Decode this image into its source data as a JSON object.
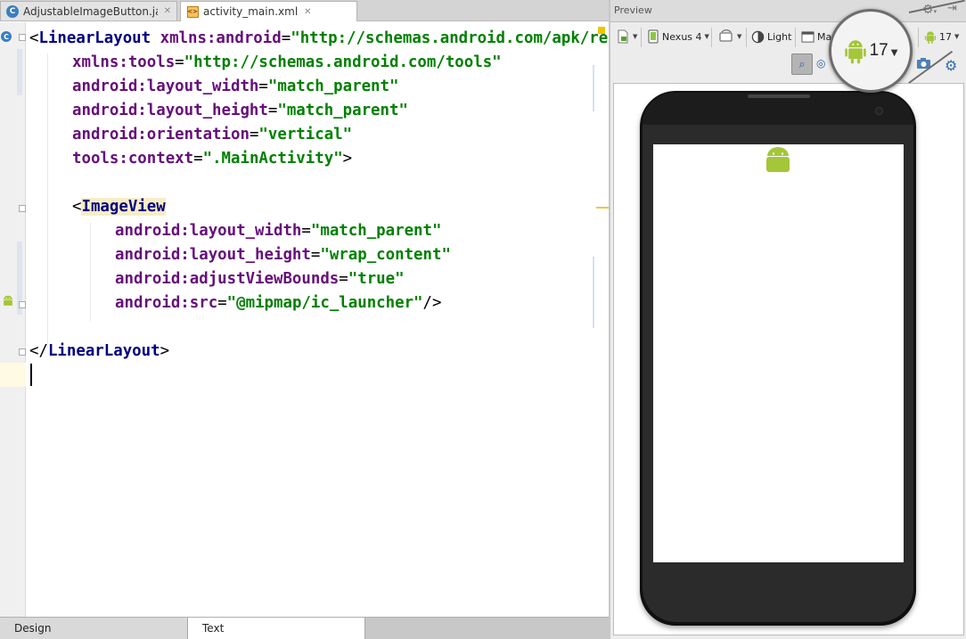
{
  "editor_tabs": [
    {
      "label": "AdjustableImageButton.java",
      "icon": "java-class-icon",
      "active": false
    },
    {
      "label": "activity_main.xml",
      "icon": "xml-layout-icon",
      "active": true
    }
  ],
  "code": {
    "line1": {
      "lt": "<",
      "tag": "LinearLayout",
      "attr": "xmlns:android",
      "eq": "=",
      "value": "\"http://schemas.android.com/apk/res/android\""
    },
    "line2": {
      "attr": "xmlns:tools",
      "eq": "=",
      "value": "\"http://schemas.android.com/tools\""
    },
    "line3": {
      "attr": "android:layout_width",
      "eq": "=",
      "value": "\"match_parent\""
    },
    "line4": {
      "attr": "android:layout_height",
      "eq": "=",
      "value": "\"match_parent\""
    },
    "line5": {
      "attr": "android:orientation",
      "eq": "=",
      "value": "\"vertical\""
    },
    "line6": {
      "attr": "tools:context",
      "eq": "=",
      "value": "\".MainActivity\"",
      "end": ">"
    },
    "line8": {
      "lt": "<",
      "tag": "ImageView"
    },
    "line9": {
      "attr": "android:layout_width",
      "eq": "=",
      "value": "\"match_parent\""
    },
    "line10": {
      "attr": "android:layout_height",
      "eq": "=",
      "value": "\"wrap_content\""
    },
    "line11": {
      "attr": "android:adjustViewBounds",
      "eq": "=",
      "value": "\"true\""
    },
    "line12": {
      "attr": "android:src",
      "eq": "=",
      "value": "\"@mipmap/ic_launcher\"",
      "end": "/>"
    },
    "line14": {
      "lt": "</",
      "tag": "LinearLayout",
      "end": ">"
    }
  },
  "bottom_tabs": {
    "design": "Design",
    "text": "Text"
  },
  "preview": {
    "title": "Preview",
    "toolbar": {
      "device": "Nexus 4",
      "theme": "Light",
      "activity": "Ma",
      "api_level": "17"
    },
    "magnifier_api_level": "17"
  },
  "colors": {
    "android_green": "#a4c639",
    "xml_tag": "#000080",
    "xml_attribute": "#660e7a",
    "xml_value": "#008000"
  }
}
